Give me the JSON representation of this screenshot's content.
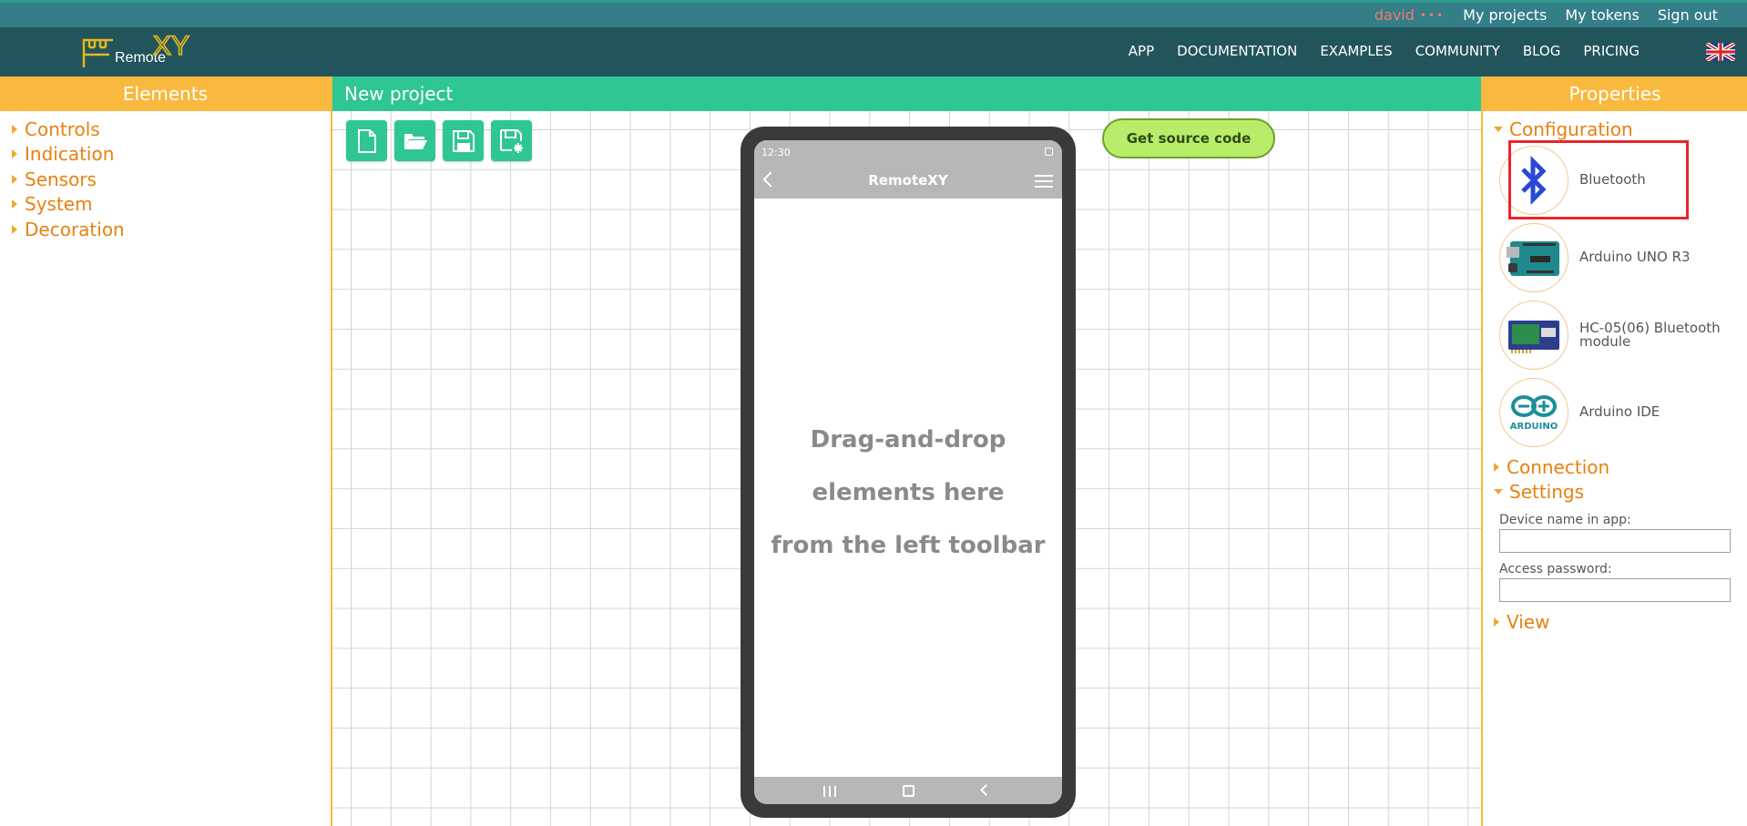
{
  "topbar": {
    "user": "david",
    "user_dots": "•••",
    "links": [
      "My projects",
      "My tokens",
      "Sign out"
    ]
  },
  "nav": {
    "logo_text": "RemoteXY",
    "logo_main": "Remote",
    "logo_xy": "XY",
    "items": [
      "APP",
      "DOCUMENTATION",
      "EXAMPLES",
      "COMMUNITY",
      "BLOG",
      "PRICING"
    ],
    "language_icon": "uk-flag-icon"
  },
  "left_panel": {
    "title": "Elements",
    "items": [
      "Controls",
      "Indication",
      "Sensors",
      "System",
      "Decoration"
    ]
  },
  "center": {
    "title": "New project",
    "toolbar_icons": [
      "new-file-icon",
      "open-folder-icon",
      "save-icon",
      "save-as-icon"
    ],
    "source_button": "Get source code",
    "phone": {
      "time": "12:30",
      "app_title": "RemoteXY",
      "hint_lines": [
        "Drag-and-drop",
        "elements here",
        "from the left toolbar"
      ]
    }
  },
  "right_panel": {
    "title": "Properties",
    "configuration_title": "Configuration",
    "config_items": [
      {
        "label": "Bluetooth",
        "icon": "bluetooth-icon"
      },
      {
        "label": "Arduino UNO R3",
        "icon": "arduino-board-icon"
      },
      {
        "label": "HC-05(06) Bluetooth module",
        "icon": "bt-module-icon"
      },
      {
        "label": "Arduino IDE",
        "icon": "arduino-logo-icon"
      }
    ],
    "connection_title": "Connection",
    "settings_title": "Settings",
    "device_name_label": "Device name in app:",
    "device_name_value": "",
    "password_label": "Access password:",
    "password_value": "",
    "view_title": "View"
  },
  "colors": {
    "topbar": "#347e87",
    "navbar": "#22545c",
    "panel_orange": "#f9b83e",
    "accent_green": "#2ec694",
    "text_orange": "#e88010",
    "highlight_red": "#e8262a"
  }
}
